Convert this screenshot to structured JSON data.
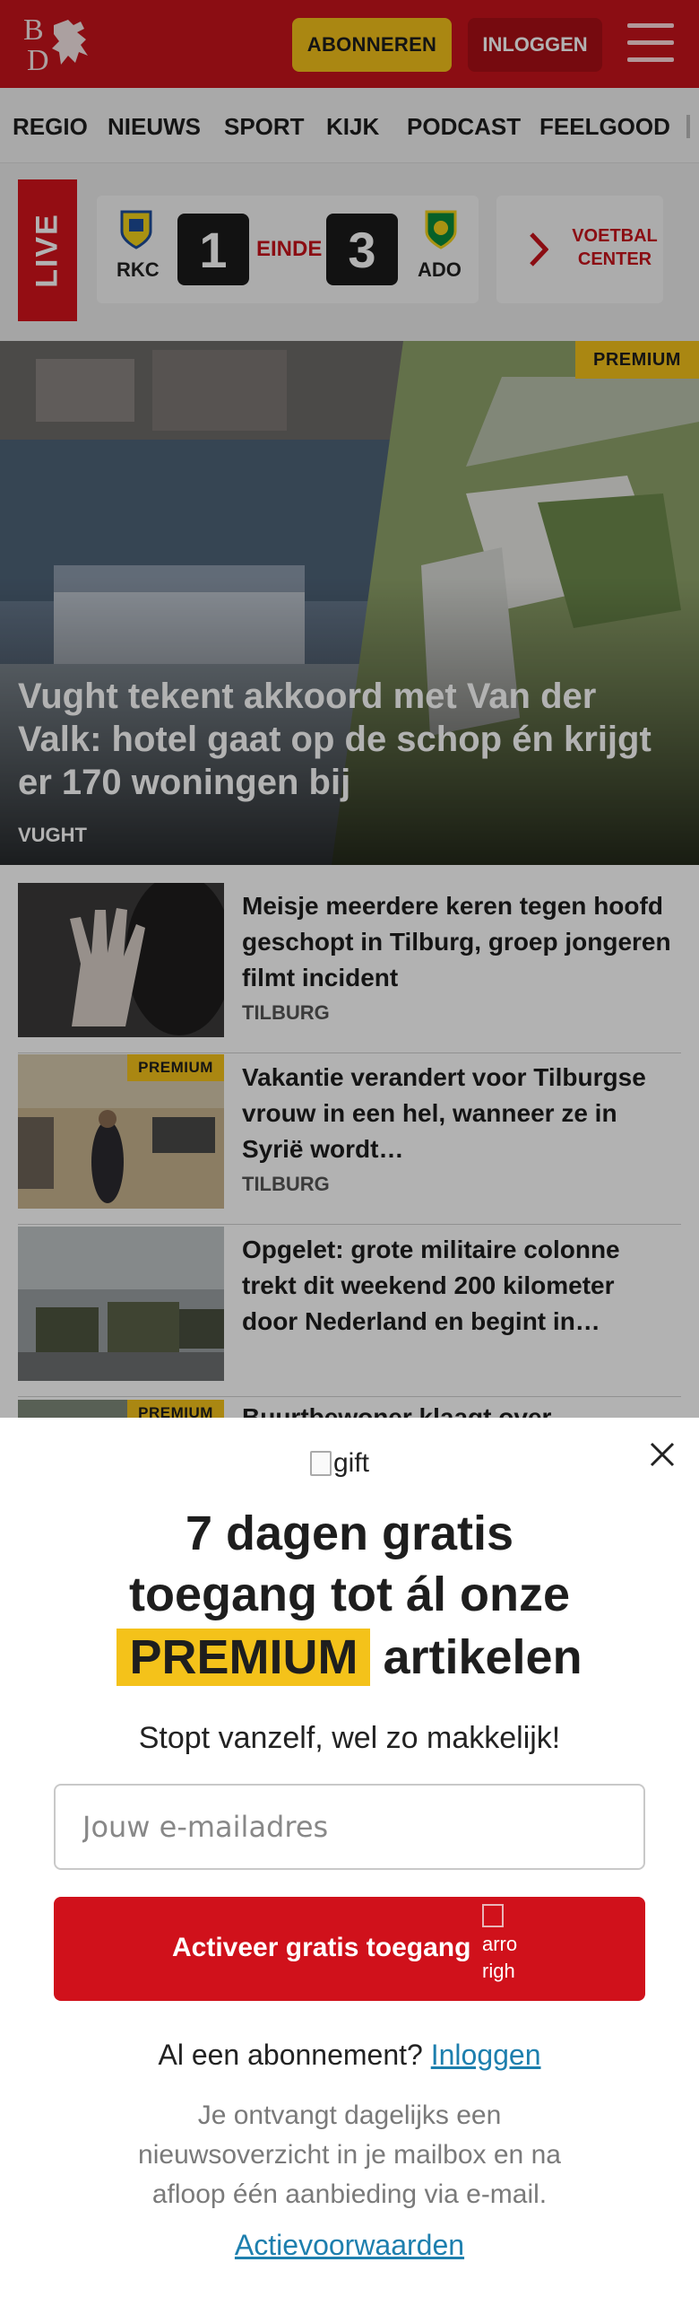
{
  "header": {
    "logo_alt": "BD",
    "subscribe_label": "ABONNEREN",
    "login_label": "INLOGGEN",
    "brand_red": "#c8141c",
    "accent_yellow": "#f4c21a"
  },
  "nav": {
    "items": [
      "REGIO",
      "NIEUWS",
      "SPORT",
      "KIJK",
      "PODCAST",
      "FEELGOOD"
    ]
  },
  "live": {
    "label": "LIVE",
    "home_team": "RKC",
    "away_team": "ADO",
    "home_score": "1",
    "away_score": "3",
    "status": "EINDE",
    "center_label_1": "VOETBAL",
    "center_label_2": "CENTER"
  },
  "hero": {
    "badge": "PREMIUM",
    "title": "Vught tekent akkoord met Van der Valk: hotel gaat op de schop én krijgt er 170 woningen bij",
    "location": "VUGHT"
  },
  "articles": [
    {
      "title": "Meisje meerdere keren tegen hoofd geschopt in Tilburg, groep jongeren filmt incident",
      "location": "TILBURG",
      "badge": ""
    },
    {
      "title": "Vakantie verandert voor Tilburgse vrouw in een hel, wanneer ze in Syrië wordt…",
      "location": "TILBURG",
      "badge": "PREMIUM"
    },
    {
      "title": "Opgelet: grote militaire colonne trekt dit weekend 200 kilometer door Nederland en begint in…",
      "location": "",
      "badge": ""
    },
    {
      "title": "Buurtbewoner klaagt over",
      "location": "",
      "badge": "PREMIUM"
    }
  ],
  "modal": {
    "gift_alt": "gift",
    "heading_line1": "7 dagen gratis",
    "heading_line2": "toegang tot ál onze",
    "heading_premium": "PREMIUM",
    "heading_line3_rest": "artikelen",
    "subheading": "Stopt vanzelf, wel zo makkelijk!",
    "email_placeholder": "Jouw e-mailadres",
    "cta_label": "Activeer gratis toegang",
    "cta_icon_alt_1": "arro",
    "cta_icon_alt_2": "righ",
    "already_text": "Al een abonnement?",
    "already_link": "Inloggen",
    "info_text": "Je ontvangt dagelijks een nieuwsoverzicht in je mailbox en na afloop één aanbieding via e-mail.",
    "terms_link": "Actievoorwaarden"
  }
}
